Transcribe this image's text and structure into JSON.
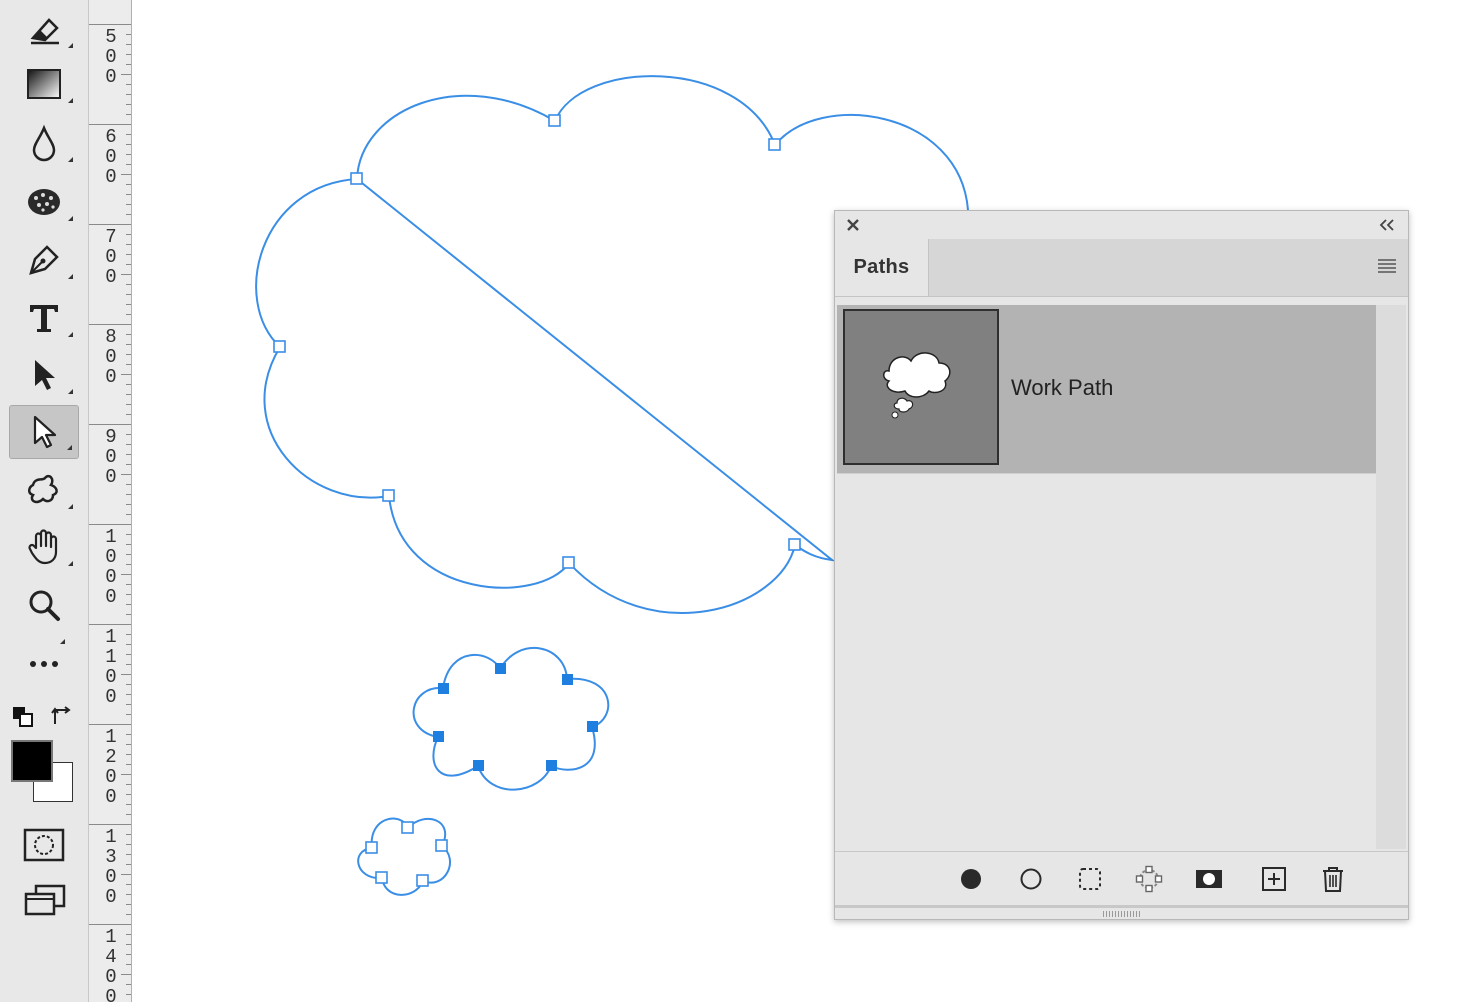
{
  "toolbar": {
    "tools": [
      {
        "name": "eraser-tool",
        "icon": "eraser-icon",
        "selected": false
      },
      {
        "name": "gradient-tool",
        "icon": "gradient-icon",
        "selected": false
      },
      {
        "name": "blur-tool",
        "icon": "droplet-icon",
        "selected": false
      },
      {
        "name": "sponge-tool",
        "icon": "sponge-icon",
        "selected": false
      },
      {
        "name": "pen-tool",
        "icon": "pen-nib-icon",
        "selected": false
      },
      {
        "name": "type-tool",
        "icon": "type-icon",
        "selected": false
      },
      {
        "name": "path-selection-tool",
        "icon": "black-arrow-icon",
        "selected": false
      },
      {
        "name": "direct-selection-tool",
        "icon": "white-arrow-icon",
        "selected": true
      },
      {
        "name": "custom-shape-tool",
        "icon": "blob-shape-icon",
        "selected": false
      },
      {
        "name": "hand-tool",
        "icon": "hand-icon",
        "selected": false
      },
      {
        "name": "zoom-tool",
        "icon": "magnifier-icon",
        "selected": false
      },
      {
        "name": "more-tools",
        "icon": "ellipsis-icon",
        "selected": false
      }
    ],
    "foreground_color": "#000000",
    "background_color": "#ffffff"
  },
  "ruler": {
    "labels": [
      "500",
      "600",
      "700",
      "800",
      "900",
      "1000",
      "1100",
      "1200",
      "1300",
      "1400"
    ]
  },
  "canvas": {
    "path_color": "#3a8ee6",
    "anchor_selected_color": "#1e7fe0"
  },
  "paths_panel": {
    "tab_label": "Paths",
    "paths": [
      {
        "name": "Work Path",
        "selected": true
      }
    ],
    "footer_buttons": [
      {
        "name": "fill-path-button",
        "icon": "filled-circle-icon"
      },
      {
        "name": "stroke-path-button",
        "icon": "hollow-circle-icon"
      },
      {
        "name": "load-selection-button",
        "icon": "dashed-selection-icon"
      },
      {
        "name": "make-work-path-button",
        "icon": "work-path-icon"
      },
      {
        "name": "add-mask-button",
        "icon": "mask-icon"
      },
      {
        "name": "new-path-button",
        "icon": "plus-square-icon"
      },
      {
        "name": "delete-path-button",
        "icon": "trash-icon"
      }
    ]
  }
}
